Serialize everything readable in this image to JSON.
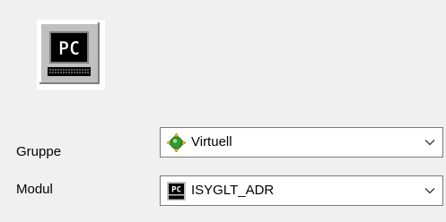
{
  "header": {
    "icon": "pc-terminal-icon",
    "icon_text": "PC"
  },
  "fields": {
    "gruppe": {
      "label": "Gruppe",
      "value": "Virtuell",
      "icon": "virtual-group-icon"
    },
    "modul": {
      "label": "Modul",
      "value": "ISYGLT_ADR",
      "icon": "pc-module-icon",
      "icon_text": "PC"
    }
  },
  "colors": {
    "background": "#f0f0f0",
    "field_background": "#ffffff",
    "field_border": "#7a7a7a",
    "virtual_icon_yellow": "#f2c21b",
    "virtual_icon_green": "#2e9d2e",
    "pc_icon_screen": "#000000"
  }
}
